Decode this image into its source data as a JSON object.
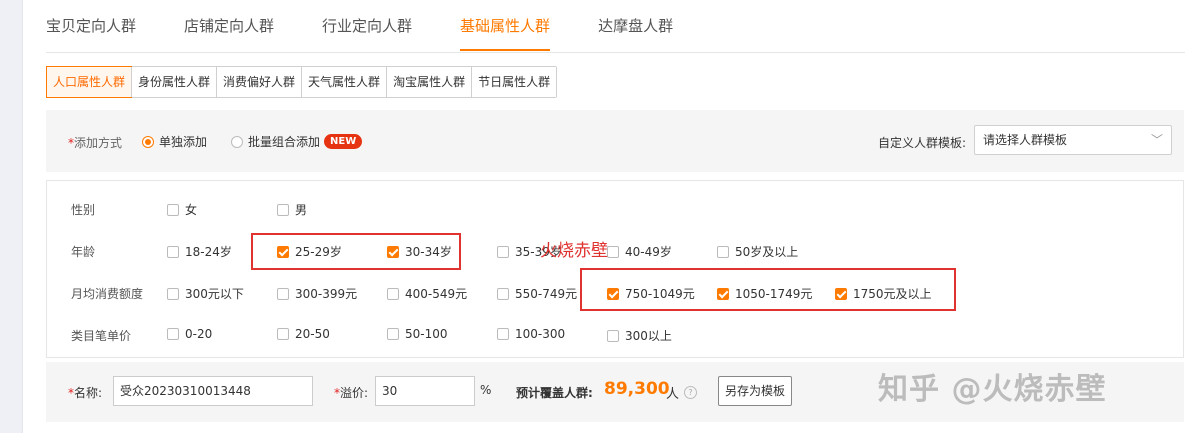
{
  "top_tabs": [
    {
      "label": "宝贝定向人群",
      "active": false
    },
    {
      "label": "店铺定向人群",
      "active": false
    },
    {
      "label": "行业定向人群",
      "active": false
    },
    {
      "label": "基础属性人群",
      "active": true
    },
    {
      "label": "达摩盘人群",
      "active": false
    }
  ],
  "sub_tabs": [
    {
      "label": "人口属性人群",
      "active": true
    },
    {
      "label": "身份属性人群",
      "active": false
    },
    {
      "label": "消费偏好人群",
      "active": false
    },
    {
      "label": "天气属性人群",
      "active": false
    },
    {
      "label": "淘宝属性人群",
      "active": false
    },
    {
      "label": "节日属性人群",
      "active": false
    }
  ],
  "method": {
    "required_mark": "*",
    "label": "添加方式",
    "option_single": "单独添加",
    "option_batch": "批量组合添加",
    "badge": "NEW",
    "template_label": "自定义人群模板:",
    "template_placeholder": "请选择人群模板"
  },
  "attributes": {
    "gender": {
      "label": "性别",
      "options": [
        {
          "text": "女",
          "checked": false
        },
        {
          "text": "男",
          "checked": false
        }
      ]
    },
    "age": {
      "label": "年龄",
      "options": [
        {
          "text": "18-24岁",
          "checked": false
        },
        {
          "text": "25-29岁",
          "checked": true
        },
        {
          "text": "30-34岁",
          "checked": true
        },
        {
          "text": "35-39岁",
          "checked": false
        },
        {
          "text": "40-49岁",
          "checked": false
        },
        {
          "text": "50岁及以上",
          "checked": false
        }
      ]
    },
    "spending": {
      "label": "月均消费额度",
      "options": [
        {
          "text": "300元以下",
          "checked": false
        },
        {
          "text": "300-399元",
          "checked": false
        },
        {
          "text": "400-549元",
          "checked": false
        },
        {
          "text": "550-749元",
          "checked": false
        },
        {
          "text": "750-1049元",
          "checked": true
        },
        {
          "text": "1050-1749元",
          "checked": true
        },
        {
          "text": "1750元及以上",
          "checked": true
        }
      ]
    },
    "unit_price": {
      "label": "类目笔单价",
      "options": [
        {
          "text": "0-20",
          "checked": false
        },
        {
          "text": "20-50",
          "checked": false
        },
        {
          "text": "50-100",
          "checked": false
        },
        {
          "text": "100-300",
          "checked": false
        },
        {
          "text": "300以上",
          "checked": false
        }
      ]
    }
  },
  "watermark_mid": "火烧赤壁",
  "bottom": {
    "required_mark": "*",
    "name_label": "名称:",
    "name_value": "受众20230310013448",
    "premium_label": "溢价:",
    "premium_value": "30",
    "percent": "%",
    "cover_label": "预计覆盖人群:",
    "cover_value": "89,300",
    "cover_unit": "人",
    "help_glyph": "?",
    "save_template": "另存为模板"
  },
  "watermark_corner": "知乎 @火烧赤壁",
  "colors": {
    "accent": "#ff7a00",
    "highlight": "#e0322f",
    "badge": "#e63312"
  }
}
